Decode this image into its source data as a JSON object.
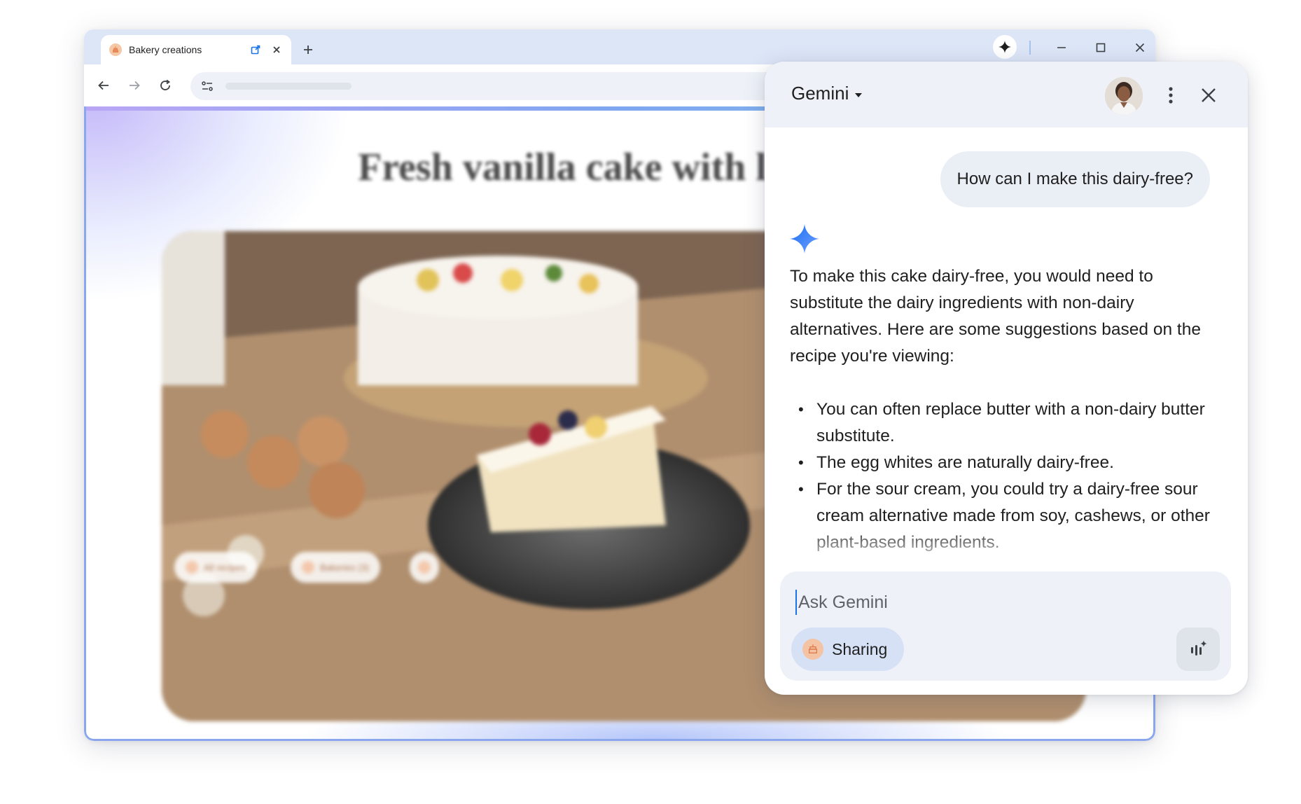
{
  "browser": {
    "tab": {
      "title": "Bakery creations"
    },
    "new_tab_icon": "plus-icon",
    "window_controls": [
      "minimize-icon",
      "maximize-icon",
      "close-icon"
    ]
  },
  "page": {
    "title": "Fresh vanilla cake with l",
    "chips": [
      "All recipes",
      "Bakeries (3)"
    ]
  },
  "gemini": {
    "title": "Gemini",
    "user_message": "How can I make this dairy-free?",
    "response": {
      "intro": "To make this cake dairy-free, you would need to substitute the dairy ingredients with non-dairy alternatives. Here are some suggestions based on the recipe you're viewing:",
      "bullets": [
        "You can often replace butter with a non-dairy butter substitute.",
        "The egg whites are naturally dairy-free.",
        "For the sour cream, you could try a dairy-free sour cream alternative made from soy, cashews, or other plant-based ingredients."
      ]
    },
    "input": {
      "placeholder": "Ask Gemini",
      "value": ""
    },
    "sharing_label": "Sharing"
  },
  "colors": {
    "tabstrip": "#dce6f7",
    "panel_header": "#eef1f7",
    "user_bubble": "#eaeef5",
    "sharing_chip": "#d7e1f6",
    "gemini_spark": "#4285f4",
    "favicon": "#f6c7a4"
  }
}
